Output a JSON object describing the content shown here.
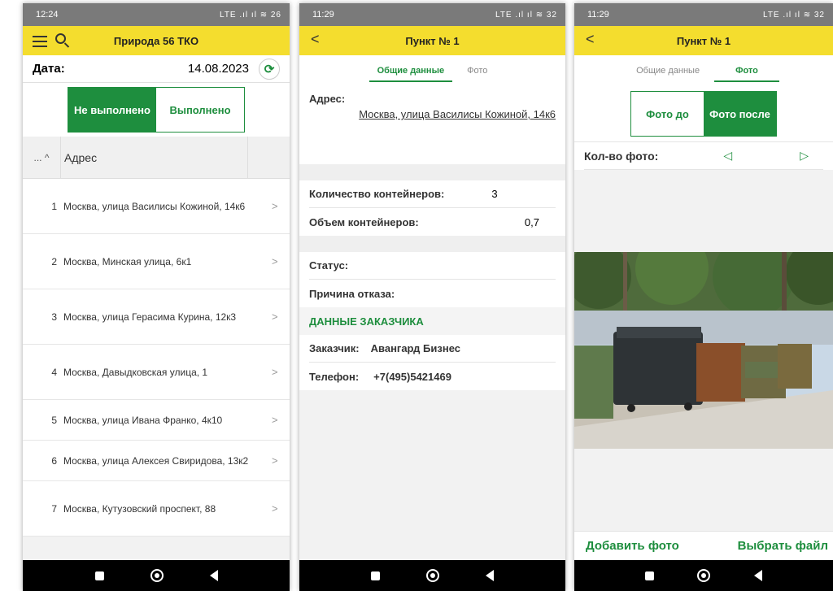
{
  "phone1": {
    "status_time": "12:24",
    "status_right": "LTE .ıl ıl ≋ 26",
    "title": "Природа 56 ТКО",
    "date_label": "Дата:",
    "date_value": "14.08.2023",
    "seg_not_done": "Не выполнено",
    "seg_done": "Выполнено",
    "col_sort": "... ^",
    "col_address": "Адрес",
    "rows": [
      {
        "num": "1",
        "address": "Москва, улица Василисы Кожиной, 14к6"
      },
      {
        "num": "2",
        "address": "Москва, Минская улица, 6к1"
      },
      {
        "num": "3",
        "address": "Москва, улица Герасима Курина, 12к3"
      },
      {
        "num": "4",
        "address": "Москва, Давыдковская улица, 1"
      },
      {
        "num": "5",
        "address": "Москва, улица Ивана Франко, 4к10"
      },
      {
        "num": "6",
        "address": "Москва, улица Алексея Свиридова, 13к2"
      },
      {
        "num": "7",
        "address": "Москва, Кутузовский проспект, 88"
      }
    ]
  },
  "phone2": {
    "status_time": "11:29",
    "status_right": "LTE .ıl ıl ≋ 32",
    "title": "Пункт № 1",
    "tab_general": "Общие данные",
    "tab_photo": "Фото",
    "address_label": "Адрес:",
    "address_value": "Москва, улица Василисы Кожиной, 14к6",
    "containers_count_label": "Количество контейнеров:",
    "containers_count_value": "3",
    "containers_volume_label": "Объем контейнеров:",
    "containers_volume_value": "0,7",
    "status_label": "Статус:",
    "reject_label": "Причина отказа:",
    "customer_section": "ДАННЫЕ ЗАКАЗЧИКА",
    "customer_label": "Заказчик:",
    "customer_value": "Авангард Бизнес",
    "phone_label": "Телефон:",
    "phone_value": "+7(495)5421469"
  },
  "phone3": {
    "status_time": "11:29",
    "status_right": "LTE .ıl ıl ≋ 32",
    "title": "Пункт № 1",
    "tab_general": "Общие данные",
    "tab_photo": "Фото",
    "photo_before": "Фото до",
    "photo_after": "Фото после",
    "photo_count_label": "Кол-во фото:",
    "add_photo": "Добавить фото",
    "choose_file": "Выбрать файл"
  },
  "colors": {
    "accent": "#1e8e3e",
    "appbar": "#f4dd2e"
  }
}
